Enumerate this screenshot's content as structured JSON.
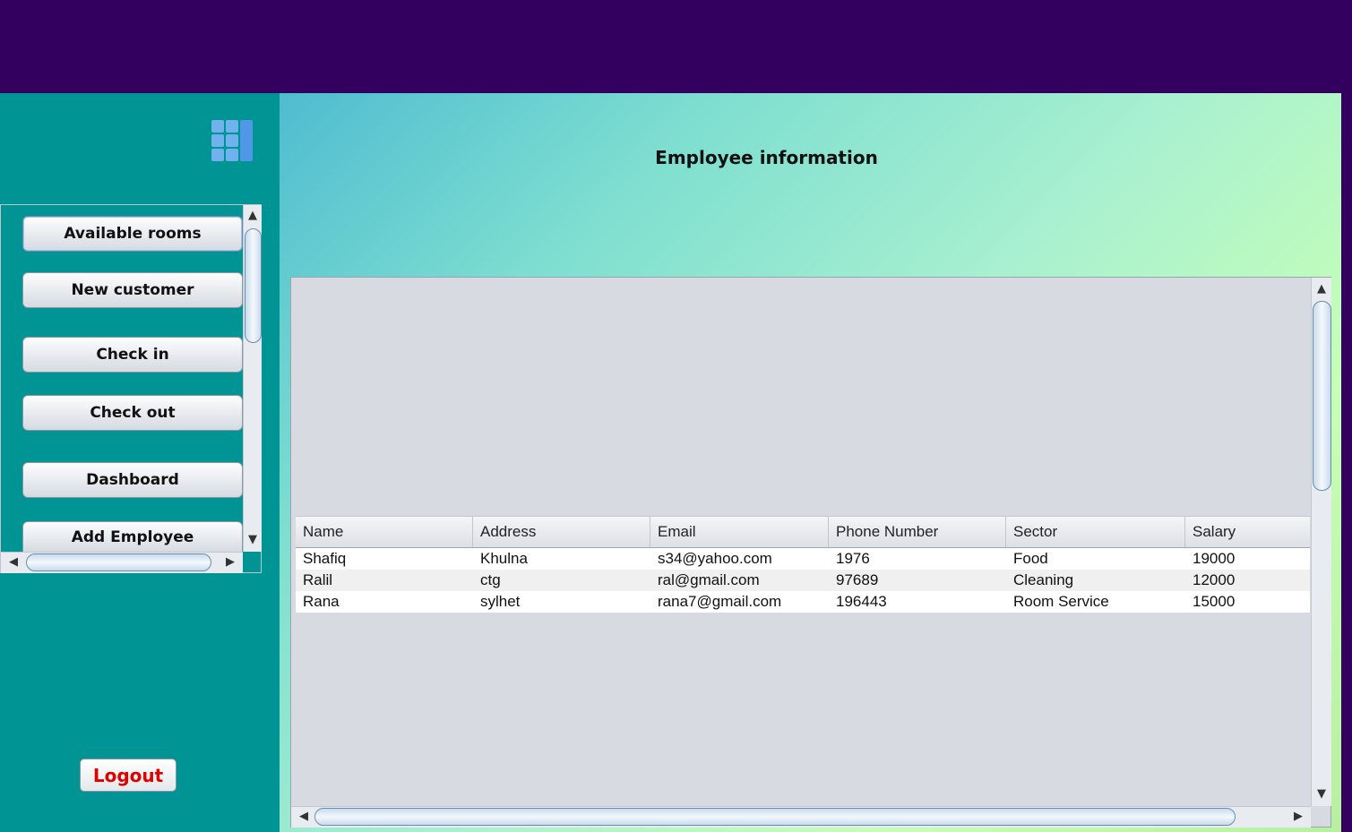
{
  "main": {
    "title": "Employee information"
  },
  "sidebar": {
    "buttons": [
      {
        "label": "Available rooms"
      },
      {
        "label": "New customer"
      },
      {
        "label": "Check in"
      },
      {
        "label": "Check out"
      },
      {
        "label": "Dashboard"
      },
      {
        "label": "Add Employee"
      }
    ],
    "logout_label": "Logout",
    "menu_icon": "grid-menu-icon"
  },
  "table": {
    "columns": [
      "Name",
      "Address",
      "Email",
      "Phone Number",
      "Sector",
      "Salary"
    ],
    "rows": [
      [
        "Shafiq",
        "Khulna",
        "s34@yahoo.com",
        "1976",
        "Food",
        "19000"
      ],
      [
        "Ralil",
        "ctg",
        "ral@gmail.com",
        "97689",
        "Cleaning",
        "12000"
      ],
      [
        "Rana",
        "sylhet",
        "rana7@gmail.com",
        "196443",
        "Room Service",
        "15000"
      ]
    ]
  },
  "colors": {
    "topbar": "#34005f",
    "sidebar": "#009494",
    "logout_text": "#e00000"
  }
}
